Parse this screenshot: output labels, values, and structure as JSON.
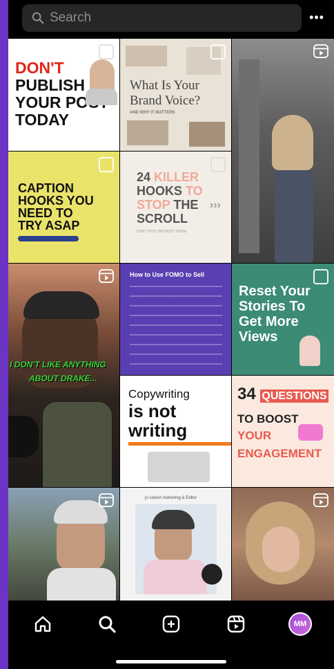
{
  "search": {
    "placeholder": "Search"
  },
  "more_label": "•••",
  "tiles": {
    "t1": {
      "lines": [
        "DON'T",
        "PUBLISH",
        "YOUR POST",
        "TODAY"
      ]
    },
    "t2": {
      "lines": [
        "What Is Your",
        "Brand Voice?"
      ],
      "sub": "AND WHY IT MATTERS"
    },
    "t4": {
      "lines": [
        "CAPTION",
        "HOOKS YOU",
        "NEED TO",
        "TRY ASAP"
      ]
    },
    "t5": {
      "w1": "24 ",
      "w2": "KILLER",
      "w3": "HOOKS ",
      "w4": "TO",
      "w5": "STOP ",
      "w6": "THE",
      "w7": "SCROLL",
      "arrow": "›››",
      "sub": "DON'T POST WITHOUT THESE"
    },
    "t6": {
      "caption1": "I DON'T LIKE ANYTHING",
      "caption2": "ABOUT DRAKE..."
    },
    "t7": {
      "title": "How to Use FOMO to Sell"
    },
    "t8": {
      "lines": [
        "Reset Your",
        "Stories To",
        "Get More",
        "Views"
      ]
    },
    "t10": {
      "l1": "Copywriting",
      "l2": "is not",
      "l3": "writing"
    },
    "t11": {
      "num": "34",
      "q": "QUESTIONS",
      "l2": "TO BOOST",
      "l3": "YOUR",
      "l4": "ENGAGEMENT"
    },
    "t13": {
      "header": "jo calvert marketing & Editor"
    }
  },
  "nav": {
    "home": "home-icon",
    "search": "search-icon",
    "create": "create-icon",
    "reels": "reels-icon",
    "profile_initials": "MM"
  },
  "colors": {
    "accent": "#6b34c4",
    "background": "#000000",
    "search_bg": "#262626"
  }
}
